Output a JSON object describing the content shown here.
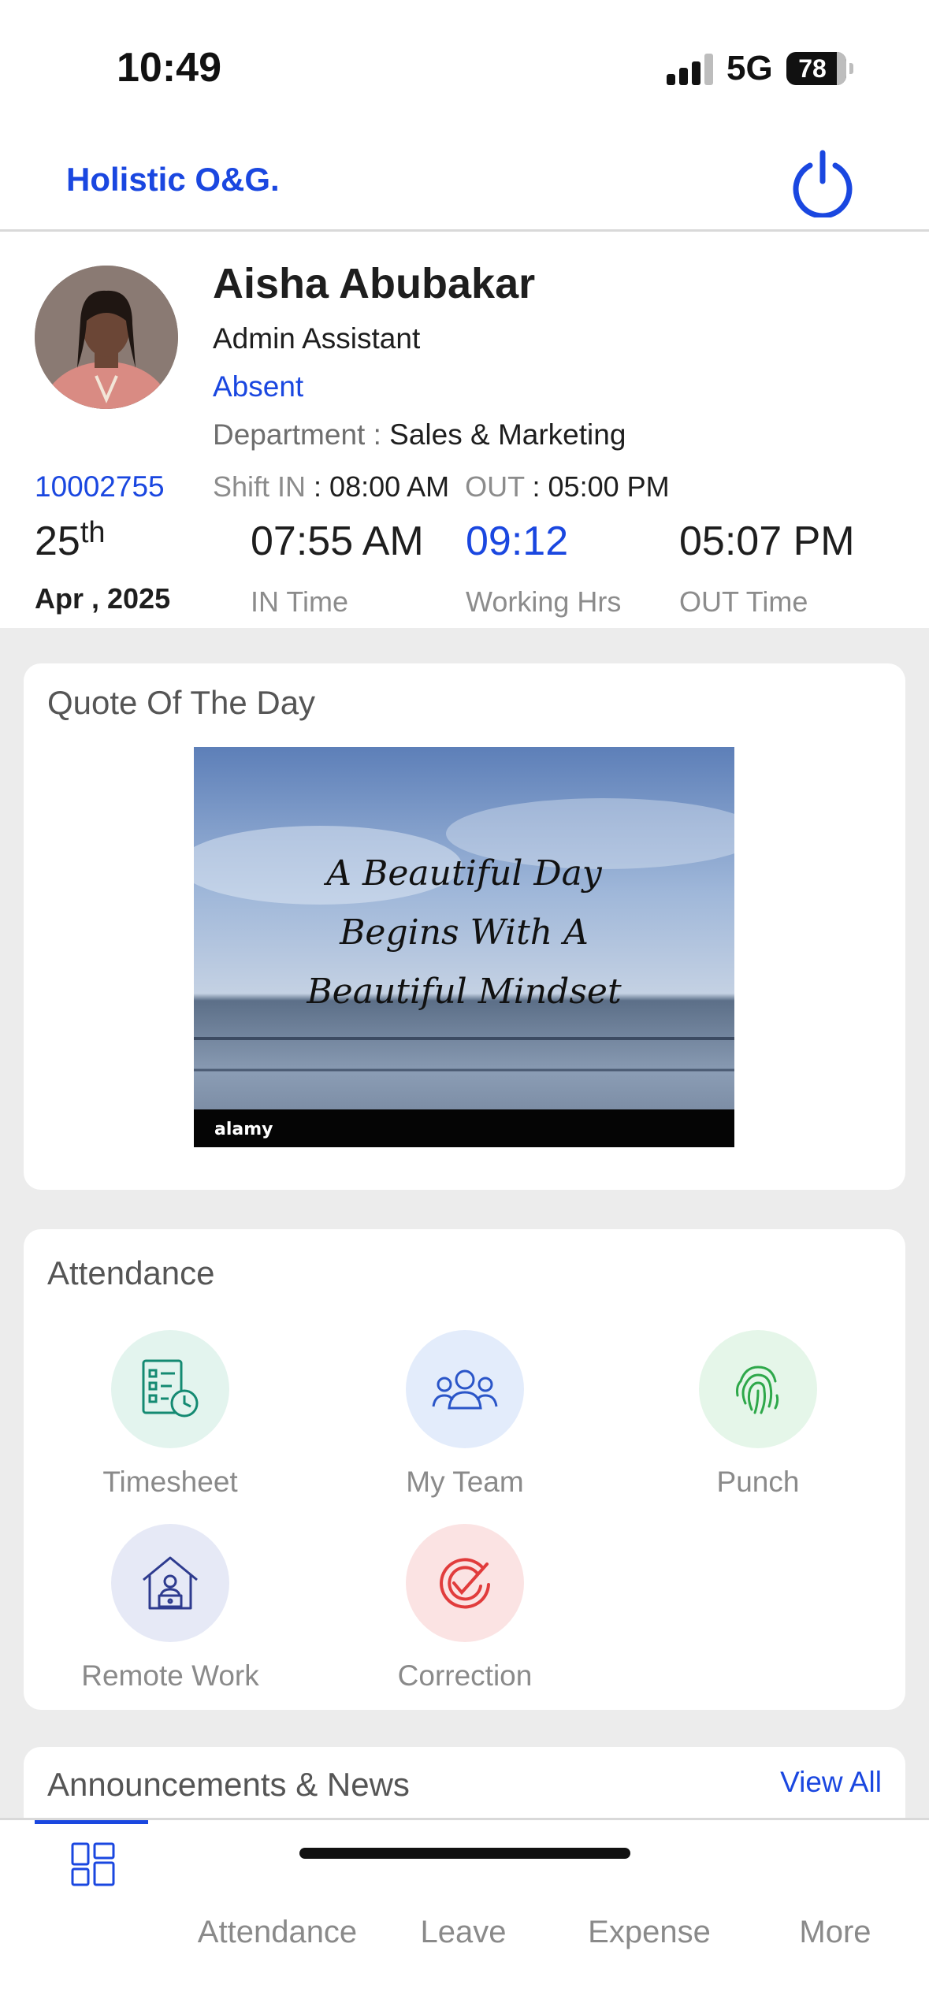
{
  "status_bar": {
    "time": "10:49",
    "network": "5G",
    "battery": "78"
  },
  "header": {
    "brand": "Holistic O&G."
  },
  "profile": {
    "name": "Aisha Abubakar",
    "role": "Admin Assistant",
    "status": "Absent",
    "department_label": "Department : ",
    "department": "Sales & Marketing",
    "employee_id": "10002755",
    "shift_in_label": "Shift IN",
    "shift_in": " : 08:00 AM",
    "shift_out_label": "OUT",
    "shift_out": " : 05:00 PM",
    "date_day": "25",
    "date_suffix": "th",
    "date_month_year": "Apr , 2025",
    "in_time": "07:55 AM",
    "in_time_label": "IN Time",
    "working_hrs": "09:12",
    "working_hrs_label": "Working Hrs",
    "out_time": "05:07 PM",
    "out_time_label": "OUT Time"
  },
  "quote": {
    "title": "Quote Of The Day",
    "image_lines": [
      "A Beautiful Day",
      "Begins With A",
      "Beautiful Mindset"
    ],
    "watermark": "alamy"
  },
  "attendance": {
    "title": "Attendance",
    "tiles": [
      {
        "label": "Timesheet",
        "icon": "timesheet-icon"
      },
      {
        "label": "My Team",
        "icon": "team-icon"
      },
      {
        "label": "Punch",
        "icon": "fingerprint-icon"
      },
      {
        "label": "Remote Work",
        "icon": "remote-work-icon"
      },
      {
        "label": "Correction",
        "icon": "correction-icon"
      }
    ]
  },
  "announcements": {
    "title": "Announcements & News",
    "view_all": "View All"
  },
  "bottom_nav": {
    "items": [
      "Attendance",
      "Leave",
      "Expense",
      "More"
    ]
  },
  "colors": {
    "accent": "#1a47e0",
    "background": "#ececec"
  }
}
